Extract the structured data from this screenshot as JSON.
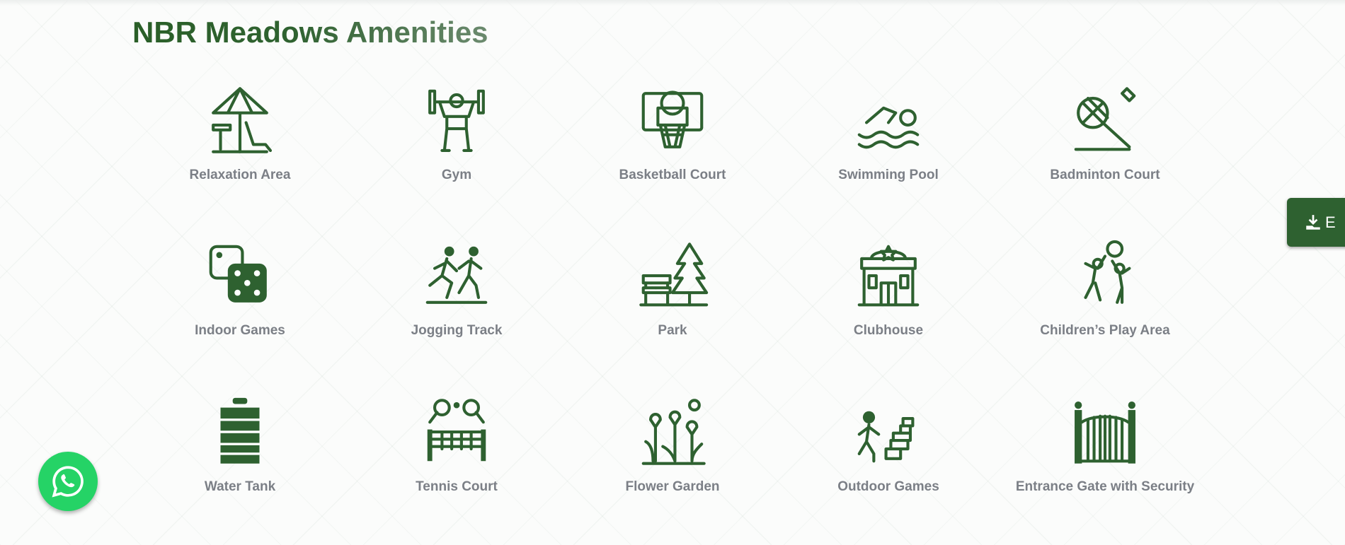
{
  "title": "NBR Meadows Amenities",
  "amenities": [
    {
      "label": "Relaxation Area",
      "icon": "beach-umbrella-icon"
    },
    {
      "label": "Gym",
      "icon": "weightlifter-icon"
    },
    {
      "label": "Basketball Court",
      "icon": "basketball-hoop-icon"
    },
    {
      "label": "Swimming Pool",
      "icon": "swimmer-icon"
    },
    {
      "label": "Badminton Court",
      "icon": "badminton-icon"
    },
    {
      "label": "Indoor Games",
      "icon": "dice-icon"
    },
    {
      "label": "Jogging Track",
      "icon": "runners-icon"
    },
    {
      "label": "Park",
      "icon": "park-bench-tree-icon"
    },
    {
      "label": "Clubhouse",
      "icon": "clubhouse-icon"
    },
    {
      "label": "Children’s Play Area",
      "icon": "children-ball-icon"
    },
    {
      "label": "Water Tank",
      "icon": "water-tank-icon"
    },
    {
      "label": "Tennis Court",
      "icon": "tennis-net-icon"
    },
    {
      "label": "Flower Garden",
      "icon": "flowers-icon"
    },
    {
      "label": "Outdoor Games",
      "icon": "hopscotch-icon"
    },
    {
      "label": "Entrance Gate with Security",
      "icon": "gate-icon"
    }
  ],
  "download_button": {
    "label": "E",
    "icon": "download-icon"
  },
  "whatsapp": {
    "icon": "whatsapp-icon"
  },
  "colors": {
    "accent": "#2e6130",
    "label": "#7b7f86",
    "whatsapp": "#25d366"
  }
}
